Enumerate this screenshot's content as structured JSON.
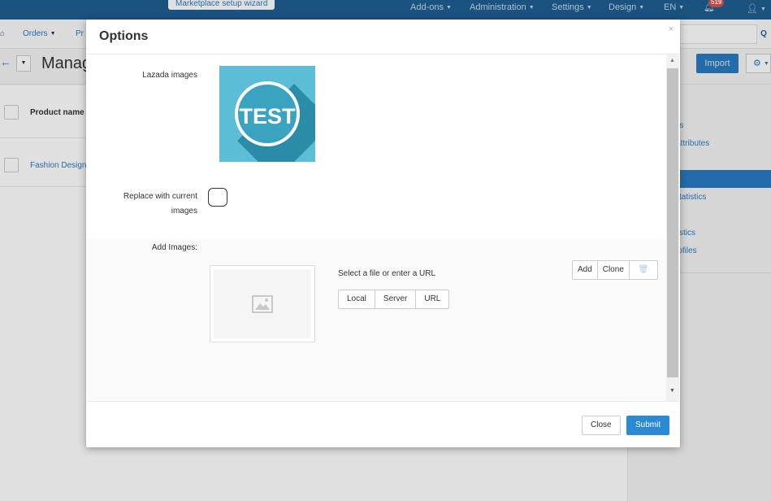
{
  "topbar": {
    "wizard_label": "Marketplace setup wizard",
    "menus": [
      "Add-ons",
      "Administration",
      "Settings",
      "Design",
      "EN"
    ],
    "notifications_count": "519"
  },
  "secbar": {
    "orders_label": "Orders",
    "products_partial": "Pr"
  },
  "toolbar": {
    "title_partial": "Manag",
    "import_label": "Import"
  },
  "list": {
    "column_header": "Product name",
    "product_partial": "Fashion Design"
  },
  "sidebar": {
    "items": [
      "es",
      "Attributes",
      "statistics",
      "tistics",
      "rofiles"
    ]
  },
  "modal": {
    "title": "Options",
    "close_glyph": "×",
    "lazada_label": "Lazada images",
    "thumbnail_text": "TEST",
    "replace_label_line1": "Replace with current",
    "replace_label_line2": "images",
    "add_images_label": "Add Images:",
    "select_text": "Select a file or enter a URL",
    "source_buttons": [
      "Local",
      "Server",
      "URL"
    ],
    "action_buttons": [
      "Add",
      "Clone"
    ],
    "close_button": "Close",
    "submit_button": "Submit"
  },
  "colors": {
    "primary": "#2a8ad4",
    "header_dark": "#1e5e92",
    "thumbnail_bg": "#3aa3c0"
  }
}
